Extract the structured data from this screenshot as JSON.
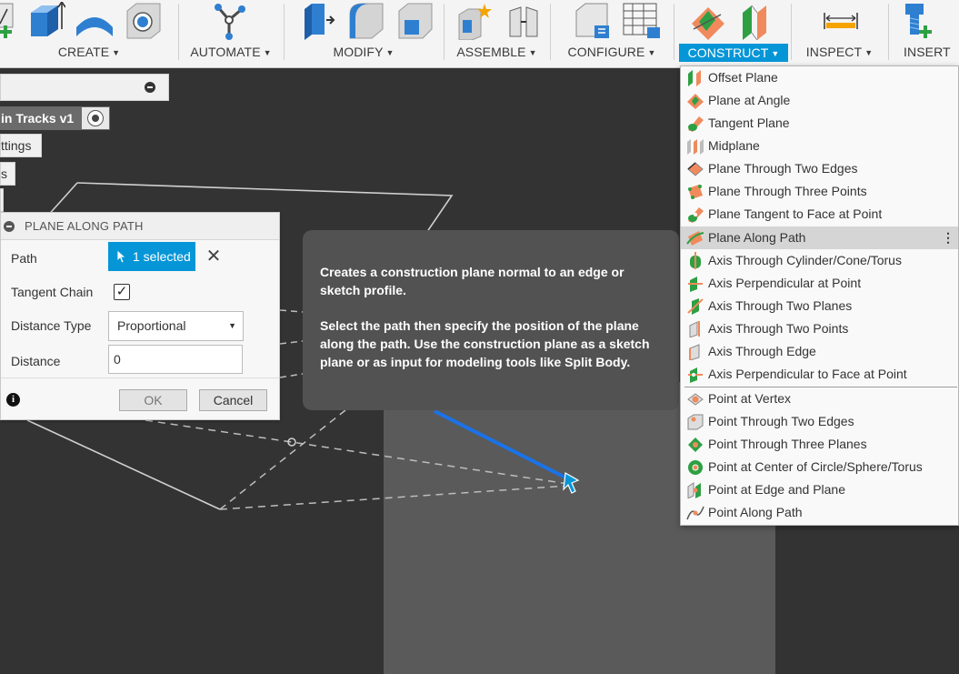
{
  "toolbar": {
    "groups": [
      {
        "label": "CREATE"
      },
      {
        "label": "AUTOMATE"
      },
      {
        "label": "MODIFY"
      },
      {
        "label": "ASSEMBLE"
      },
      {
        "label": "CONFIGURE"
      },
      {
        "label": "CONSTRUCT"
      },
      {
        "label": "INSPECT"
      },
      {
        "label": "INSERT"
      }
    ],
    "active_group": "CONSTRUCT",
    "accent_color": "#0696d7"
  },
  "browser": {
    "root_label": "in Tracks v1",
    "settings_label": "ttings",
    "item3_label": "s"
  },
  "dialog": {
    "title": "PLANE ALONG PATH",
    "path_label": "Path",
    "path_value": "1 selected",
    "tangent_label": "Tangent Chain",
    "tangent_checked": true,
    "distance_type_label": "Distance Type",
    "distance_type_value": "Proportional",
    "distance_label": "Distance",
    "distance_value": "0",
    "ok_label": "OK",
    "cancel_label": "Cancel"
  },
  "tooltip": {
    "para1": "Creates a construction plane normal to an edge or sketch profile.",
    "para2": "Select the path then specify the position of the plane along the path. Use the construction plane as a sketch plane or as input for modeling tools like Split Body."
  },
  "construct_menu": {
    "items": [
      {
        "label": "Offset Plane",
        "icon": "offset-plane-icon"
      },
      {
        "label": "Plane at Angle",
        "icon": "plane-at-angle-icon"
      },
      {
        "label": "Tangent Plane",
        "icon": "tangent-plane-icon"
      },
      {
        "label": "Midplane",
        "icon": "midplane-icon"
      },
      {
        "label": "Plane Through Two Edges",
        "icon": "plane-two-edges-icon"
      },
      {
        "label": "Plane Through Three Points",
        "icon": "plane-three-points-icon"
      },
      {
        "label": "Plane Tangent to Face at Point",
        "icon": "plane-tangent-face-icon"
      },
      {
        "label": "Plane Along Path",
        "icon": "plane-along-path-icon",
        "highlighted": true
      },
      {
        "label": "Axis Through Cylinder/Cone/Torus",
        "icon": "axis-cylinder-icon"
      },
      {
        "label": "Axis Perpendicular at Point",
        "icon": "axis-perpendicular-point-icon"
      },
      {
        "label": "Axis Through Two Planes",
        "icon": "axis-two-planes-icon"
      },
      {
        "label": "Axis Through Two Points",
        "icon": "axis-two-points-icon"
      },
      {
        "label": "Axis Through Edge",
        "icon": "axis-edge-icon"
      },
      {
        "label": "Axis Perpendicular to Face at Point",
        "icon": "axis-perpendicular-face-icon"
      },
      {
        "label": "Point at Vertex",
        "icon": "point-vertex-icon"
      },
      {
        "label": "Point Through Two Edges",
        "icon": "point-two-edges-icon"
      },
      {
        "label": "Point Through Three Planes",
        "icon": "point-three-planes-icon"
      },
      {
        "label": "Point at Center of Circle/Sphere/Torus",
        "icon": "point-center-icon"
      },
      {
        "label": "Point at Edge and Plane",
        "icon": "point-edge-plane-icon"
      },
      {
        "label": "Point Along Path",
        "icon": "point-along-path-icon"
      }
    ],
    "more_glyph": "⋮"
  },
  "colors": {
    "viewport": "#333333",
    "selection_blue": "#0696d7",
    "path_blue": "#1a73e8",
    "tooltip_bg": "#525252"
  }
}
